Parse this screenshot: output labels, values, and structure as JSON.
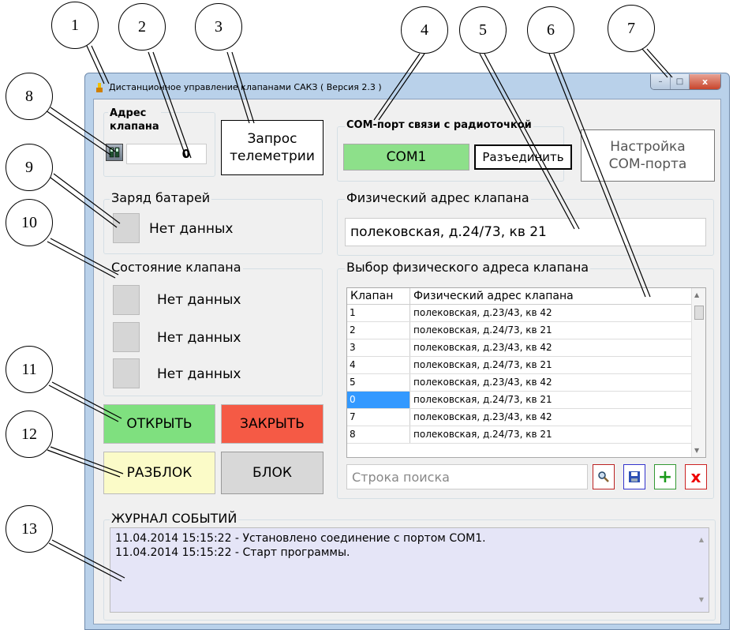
{
  "window": {
    "title": "Дистанционное управление клапанами САКЗ ( Версия 2.3 )",
    "controls": {
      "minimize": "–",
      "maximize": "□",
      "close": "x"
    }
  },
  "address": {
    "label": "Адрес\nклапана",
    "value": "0"
  },
  "telemetry_button": "Запрос\nтелеметрии",
  "com": {
    "legend": "COM-порт связи с радиоточкой",
    "port_button": "COM1",
    "disconnect_button": "Разъединить",
    "setup_button": "Настройка\nCOM-порта"
  },
  "battery": {
    "legend": "Заряд батарей",
    "status": "Нет данных"
  },
  "physical_address": {
    "legend": "Физический адрес клапана",
    "value": "полековская, д.24/73, кв 21"
  },
  "valve_state": {
    "legend": "Состояние клапана",
    "items": [
      "Нет данных",
      "Нет данных",
      "Нет данных"
    ]
  },
  "selector": {
    "legend": "Выбор физического адреса клапана",
    "columns": [
      "Клапан",
      "Физический адрес клапана"
    ],
    "rows": [
      {
        "valve": "1",
        "address": "полековская, д.23/43, кв 42",
        "selected": false
      },
      {
        "valve": "2",
        "address": "полековская, д.24/73, кв 21",
        "selected": false
      },
      {
        "valve": "3",
        "address": "полековская, д.23/43, кв 42",
        "selected": false
      },
      {
        "valve": "4",
        "address": "полековская, д.24/73, кв 21",
        "selected": false
      },
      {
        "valve": "5",
        "address": "полековская, д.23/43, кв 42",
        "selected": false
      },
      {
        "valve": "0",
        "address": "полековская, д.24/73, кв 21",
        "selected": true
      },
      {
        "valve": "7",
        "address": "полековская, д.23/43, кв 42",
        "selected": false
      },
      {
        "valve": "8",
        "address": "полековская, д.24/73, кв 21",
        "selected": false
      }
    ],
    "search_placeholder": "Строка поиска",
    "tools": {
      "search": "search-icon",
      "save": "save-icon",
      "add": "+",
      "delete": "x"
    }
  },
  "actions": {
    "open": "ОТКРЫТЬ",
    "close": "ЗАКРЫТЬ",
    "unlock": "РАЗБЛОК",
    "lock": "БЛОК"
  },
  "log": {
    "legend": "ЖУРНАЛ СОБЫТИЙ",
    "lines": [
      "11.04.2014 15:15:22 - Установлено соединение с портом COM1.",
      "11.04.2014 15:15:22 - Старт программы."
    ]
  },
  "callouts": [
    "1",
    "2",
    "3",
    "4",
    "5",
    "6",
    "7",
    "8",
    "9",
    "10",
    "11",
    "12",
    "13"
  ],
  "colors": {
    "open": "#7fe07f",
    "close": "#f55a45",
    "unlock": "#fbfbc8",
    "com1": "#8de08a",
    "selection": "#3399ff",
    "log_bg": "#e5e5f7"
  }
}
